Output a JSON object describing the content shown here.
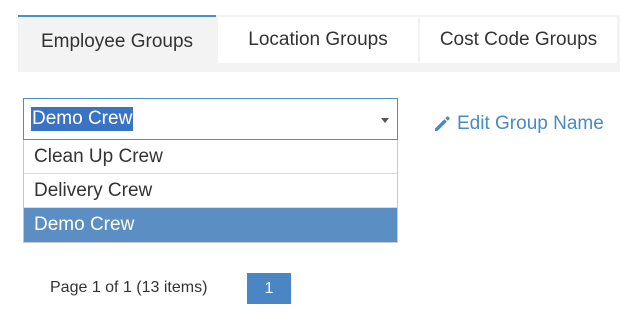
{
  "tabs": [
    {
      "label": "Employee Groups",
      "active": true
    },
    {
      "label": "Location Groups",
      "active": false
    },
    {
      "label": "Cost Code Groups",
      "active": false
    }
  ],
  "group_select": {
    "value": "Demo Crew",
    "options": [
      "Clean Up Crew",
      "Delivery Crew",
      "Demo Crew"
    ]
  },
  "edit_link": {
    "label": "Edit Group Name",
    "icon": "pencil-icon"
  },
  "pager": {
    "info": "Page 1 of 1 (13 items)",
    "current_page": "1"
  },
  "colors": {
    "accent": "#4a90c8",
    "selected_option": "#5b8fc4",
    "text_selection": "#3b73c4"
  }
}
